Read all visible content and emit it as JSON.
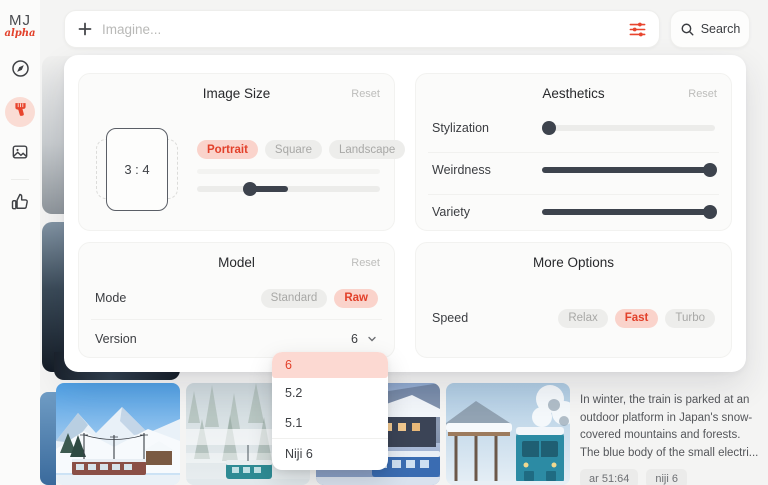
{
  "sidebar": {
    "logo": {
      "line1": "MJ",
      "line2": "alpha"
    }
  },
  "topbar": {
    "imagine": {
      "placeholder": "Imagine..."
    },
    "search_label": "Search"
  },
  "panel": {
    "image_size": {
      "title": "Image Size",
      "reset_label": "Reset",
      "aspect_ratio": "3 : 4",
      "options": [
        {
          "label": "Portrait",
          "active": true
        },
        {
          "label": "Square",
          "active": false
        },
        {
          "label": "Landscape",
          "active": false
        }
      ],
      "slider": {
        "fill_left": "29%",
        "fill_width": "21%",
        "handle_left": "29%"
      }
    },
    "aesthetics": {
      "title": "Aesthetics",
      "reset_label": "Reset",
      "sliders": [
        {
          "label": "Stylization",
          "fill_width": "0%",
          "handle_left": "4%"
        },
        {
          "label": "Weirdness",
          "fill_width": "97%",
          "handle_left": "97%"
        },
        {
          "label": "Variety",
          "fill_width": "97%",
          "handle_left": "97%"
        }
      ]
    },
    "model": {
      "title": "Model",
      "reset_label": "Reset",
      "mode_label": "Mode",
      "mode_options": [
        {
          "label": "Standard",
          "active": false
        },
        {
          "label": "Raw",
          "active": true
        }
      ],
      "version_label": "Version",
      "version_value": "6"
    },
    "more_options": {
      "title": "More Options",
      "speed_label": "Speed",
      "speed_options": [
        {
          "label": "Relax",
          "active": false
        },
        {
          "label": "Fast",
          "active": true
        },
        {
          "label": "Turbo",
          "active": false
        }
      ]
    }
  },
  "dropdown": {
    "items": [
      {
        "label": "6",
        "selected": true
      },
      {
        "label": "5.2",
        "selected": false
      },
      {
        "label": "5.1",
        "selected": false
      },
      {
        "label": "Niji 6",
        "selected": false
      }
    ]
  },
  "caption": {
    "lines": [
      "In winter, the train is parked at an",
      "outdoor platform in Japan's snow-",
      "covered mountains and forests.",
      "The blue body of the small electri..."
    ],
    "badges": [
      "ar 51:64",
      "niji 6"
    ]
  },
  "colors": {
    "accent_red": "#e2402a",
    "accent_pink": "#fad3cb",
    "slider_dark": "#3d434d"
  }
}
